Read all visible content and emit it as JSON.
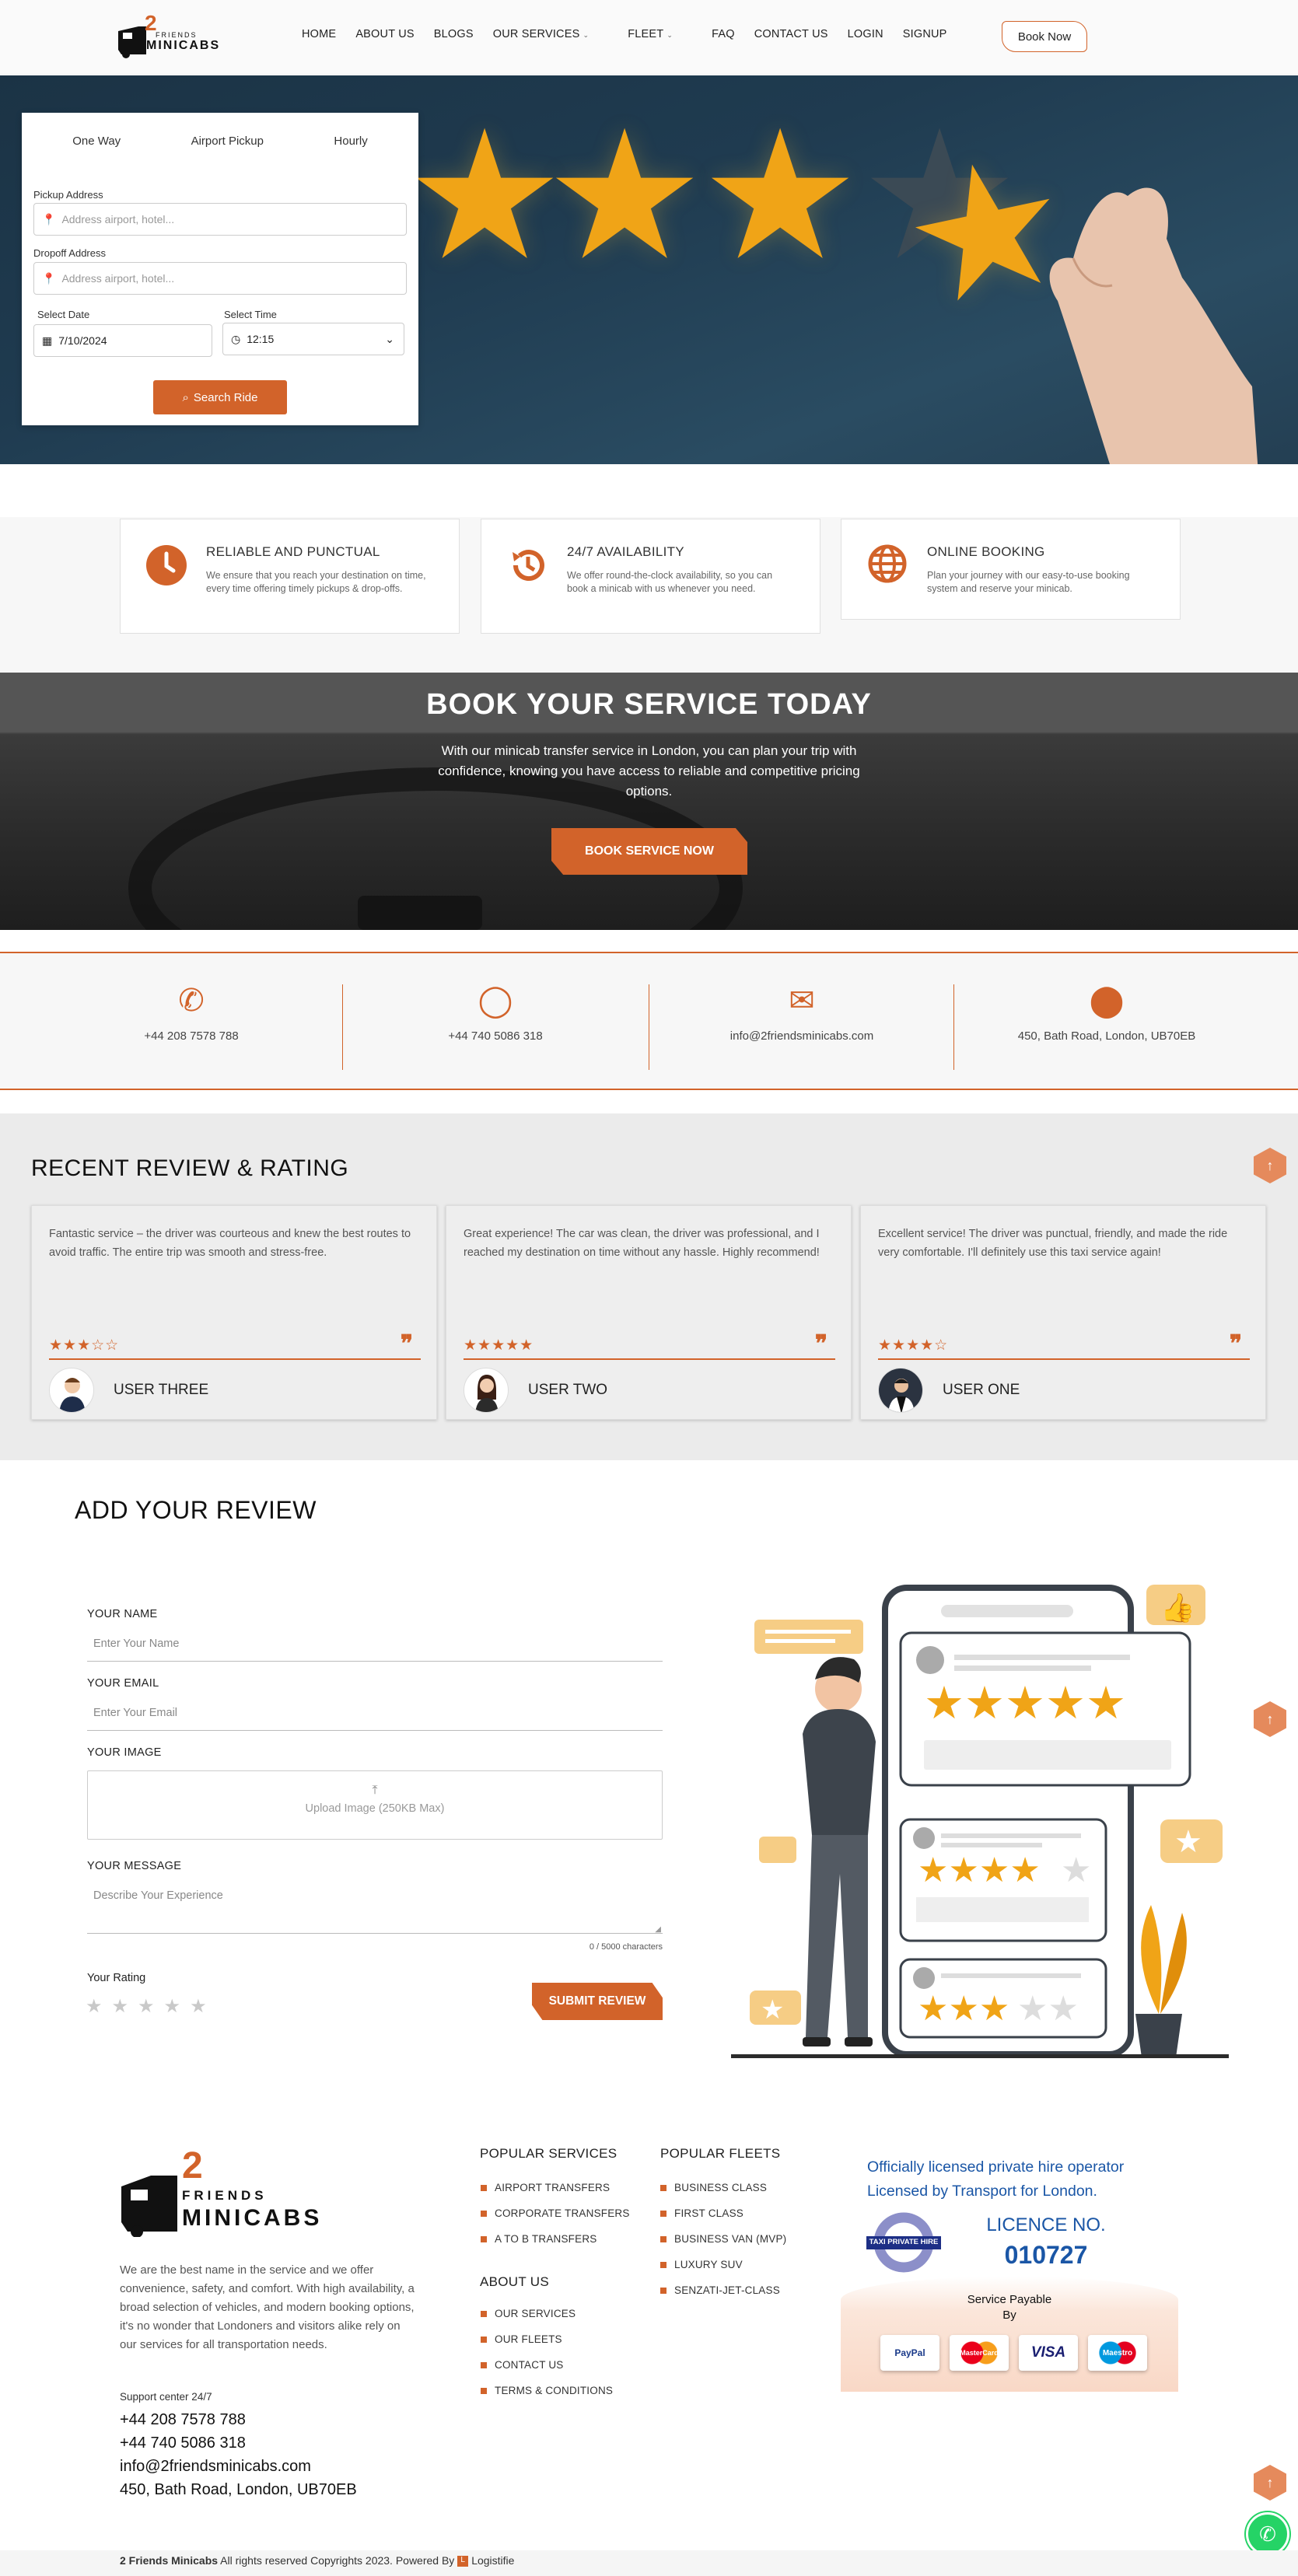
{
  "header": {
    "logo_num": "2",
    "logo_friends": "FRIENDS",
    "logo_minicabs": "MINICABS",
    "nav": [
      {
        "label": "HOME"
      },
      {
        "label": "ABOUT US"
      },
      {
        "label": "BLOGS"
      },
      {
        "label": "OUR SERVICES",
        "dropdown": true
      },
      {
        "label": "FLEET",
        "dropdown": true
      },
      {
        "label": "FAQ"
      },
      {
        "label": "CONTACT US"
      },
      {
        "label": "LOGIN"
      },
      {
        "label": "SIGNUP"
      }
    ],
    "book_now": "Book Now"
  },
  "booking": {
    "tabs": [
      "One Way",
      "Airport Pickup",
      "Hourly"
    ],
    "pickup_label": "Pickup Address",
    "pickup_placeholder": "Address airport, hotel...",
    "dropoff_label": "Dropoff Address",
    "dropoff_placeholder": "Address airport, hotel...",
    "date_label": "Select Date",
    "date_value": "7/10/2024",
    "time_label": "Select Time",
    "time_value": "12:15",
    "search_button": "Search Ride"
  },
  "features": [
    {
      "title": "RELIABLE AND PUNCTUAL",
      "desc": "We ensure that you reach your destination on time, every time offering timely pickups & drop-offs.",
      "icon": "clock-icon"
    },
    {
      "title": "24/7 AVAILABILITY",
      "desc": "We offer round-the-clock availability, so you can book a minicab with us whenever you need.",
      "icon": "history-icon"
    },
    {
      "title": "ONLINE BOOKING",
      "desc": "Plan your journey with our easy-to-use booking system and reserve your minicab.",
      "icon": "globe-icon"
    }
  ],
  "book_banner": {
    "title": "BOOK YOUR SERVICE TODAY",
    "subtitle": "With our minicab transfer service in London, you can plan your trip with confidence, knowing you have access to reliable and competitive pricing options.",
    "button": "BOOK SERVICE NOW"
  },
  "contacts": [
    {
      "icon": "phone-icon",
      "value": "+44 208 7578 788"
    },
    {
      "icon": "whatsapp-icon",
      "value": "+44 740 5086 318"
    },
    {
      "icon": "envelope-icon",
      "value": "info@2friendsminicabs.com"
    },
    {
      "icon": "map-pin-icon",
      "value": "450, Bath Road, London, UB70EB"
    }
  ],
  "reviews": {
    "title": "RECENT REVIEW & RATING",
    "items": [
      {
        "text": "Fantastic service – the driver was courteous and knew the best routes to avoid traffic. The entire trip was smooth and stress-free.",
        "rating": 3,
        "stars": "★★★☆☆",
        "name": "USER THREE"
      },
      {
        "text": "Great experience! The car was clean, the driver was professional, and I reached my destination on time without any hassle. Highly recommend!",
        "rating": 5,
        "stars": "★★★★★",
        "name": "USER TWO"
      },
      {
        "text": "Excellent service! The driver was punctual, friendly, and made the ride very comfortable. I'll definitely use this taxi service again!",
        "rating": 4,
        "stars": "★★★★☆",
        "name": "USER ONE"
      }
    ]
  },
  "add_review": {
    "title": "ADD YOUR REVIEW",
    "name_label": "YOUR NAME",
    "name_placeholder": "Enter Your Name",
    "email_label": "YOUR EMAIL",
    "email_placeholder": "Enter Your Email",
    "image_label": "YOUR IMAGE",
    "upload_text": "Upload Image (250KB Max)",
    "message_label": "YOUR MESSAGE",
    "message_placeholder": "Describe Your Experience",
    "char_count": "0 / 5000 characters",
    "rating_label": "Your Rating",
    "rating_stars": "★★★★★",
    "submit": "SUBMIT REVIEW"
  },
  "footer": {
    "about": "We are the best name in the service and we offer convenience, safety, and comfort. With high availability, a broad selection of vehicles, and modern booking options, it's no wonder that Londoners and visitors alike rely on our services for all transportation needs.",
    "support_label": "Support center 24/7",
    "phone1": "+44 208 7578 788",
    "phone2": "+44 740 5086 318",
    "email": "info@2friendsminicabs.com",
    "address": "450, Bath Road, London, UB70EB",
    "popular_services_title": "POPULAR SERVICES",
    "popular_services": [
      "AIRPORT TRANSFERS",
      "CORPORATE TRANSFERS",
      "A TO B TRANSFERS"
    ],
    "about_title": "ABOUT US",
    "about_links": [
      "OUR SERVICES",
      "OUR FLEETS",
      "CONTACT US",
      "TERMS & CONDITIONS"
    ],
    "fleets_title": "POPULAR FLEETS",
    "fleets": [
      "BUSINESS CLASS",
      "FIRST CLASS",
      "BUSINESS VAN (MVP)",
      "LUXURY SUV",
      "SENZATI-JET-CLASS"
    ],
    "licence_text": "Officially licensed private hire operator Licensed by Transport for London.",
    "roundel_text": "TAXI PRIVATE HIRE",
    "licence_label": "LICENCE NO.",
    "licence_no": "010727",
    "payable_line1": "Service Payable",
    "payable_line2": "By",
    "payment_cards": [
      "PayPal",
      "MasterCard",
      "VISA",
      "Maestro"
    ],
    "copyright_brand": "2 Friends Minicabs",
    "copyright_text": " All rights reserved Copyrights 2023. Powered By ",
    "powered_by": "Logistifie"
  },
  "colors": {
    "accent": "#d2632a",
    "hero_bg": "#1f3b50",
    "licence_blue": "#1a56a6"
  }
}
